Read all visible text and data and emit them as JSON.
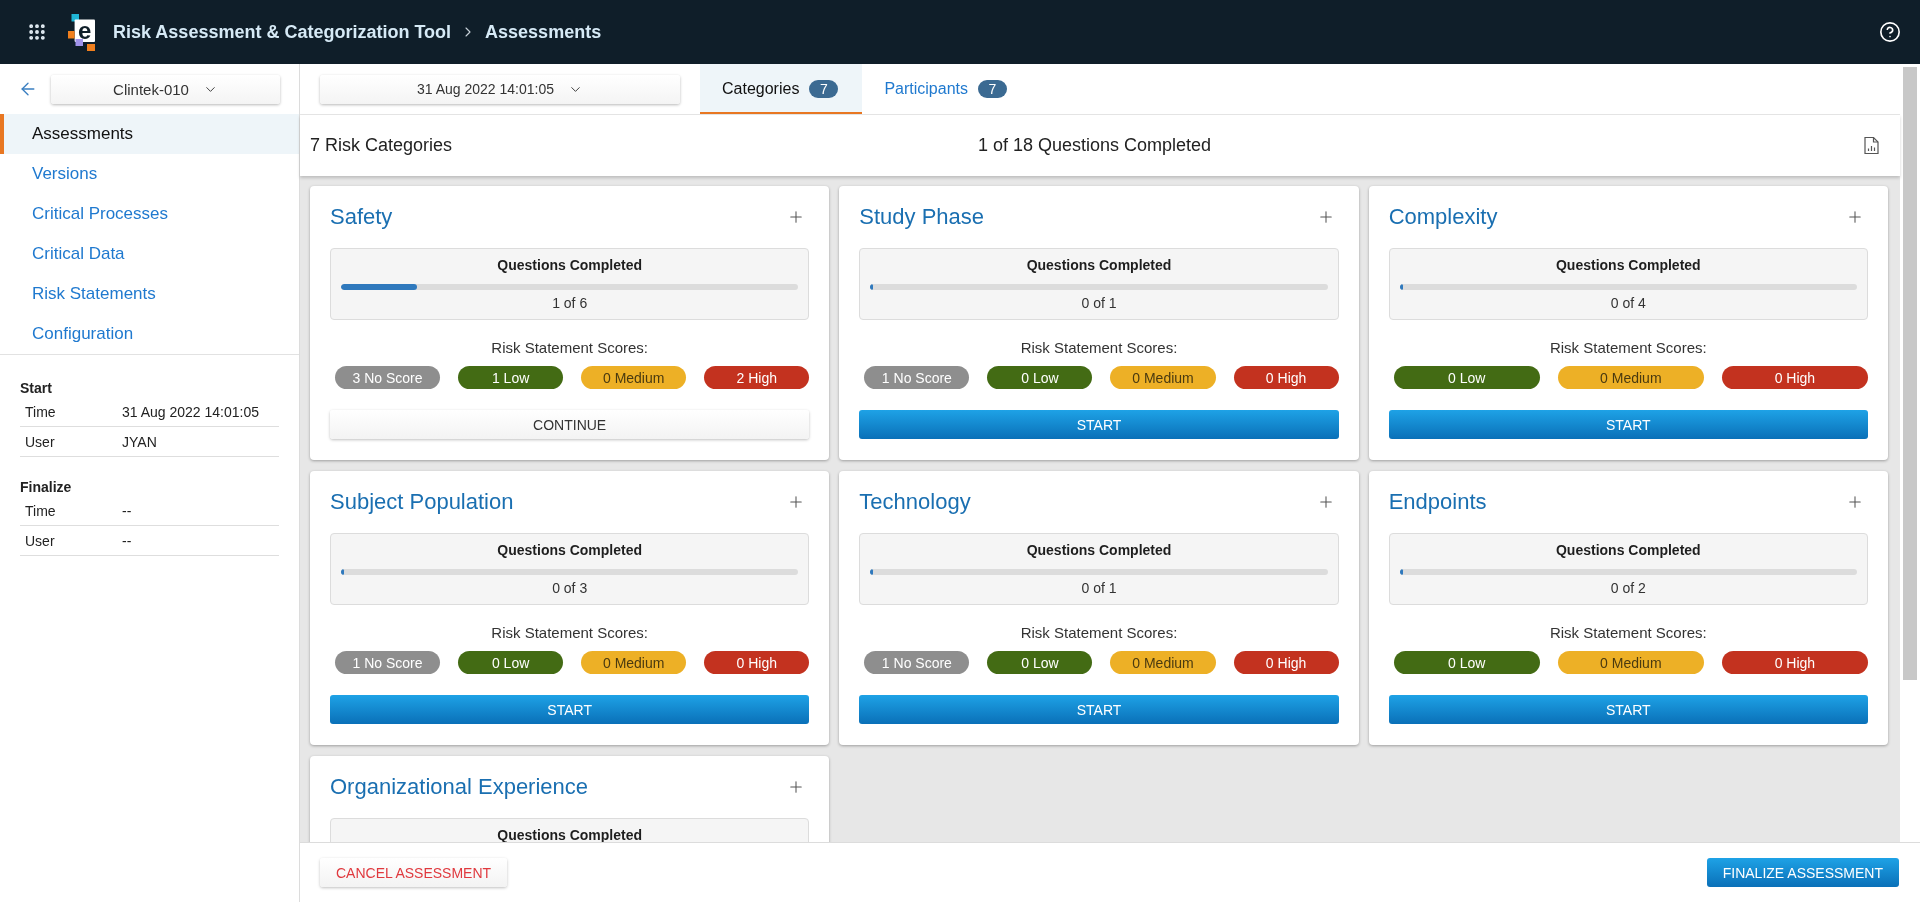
{
  "app_bar": {
    "logo_letter": "e",
    "title": "Risk Assessment & Categorization Tool",
    "page": "Assessments"
  },
  "sidebar": {
    "study": "Clintek-010",
    "nav": [
      {
        "label": "Assessments",
        "selected": true
      },
      {
        "label": "Versions",
        "selected": false
      },
      {
        "label": "Critical Processes",
        "selected": false
      },
      {
        "label": "Critical Data",
        "selected": false
      },
      {
        "label": "Risk Statements",
        "selected": false
      },
      {
        "label": "Configuration",
        "selected": false
      }
    ],
    "sections": [
      {
        "title": "Start",
        "rows": [
          {
            "label": "Time",
            "value": "31 Aug 2022 14:01:05"
          },
          {
            "label": "User",
            "value": "JYAN"
          }
        ]
      },
      {
        "title": "Finalize",
        "rows": [
          {
            "label": "Time",
            "value": "--"
          },
          {
            "label": "User",
            "value": "--"
          }
        ]
      }
    ]
  },
  "toolbar": {
    "version": "31 Aug 2022 14:01:05",
    "tabs": [
      {
        "label": "Categories",
        "count": "7",
        "selected": true
      },
      {
        "label": "Participants",
        "count": "7",
        "selected": false
      }
    ]
  },
  "summary": {
    "title": "7 Risk Categories",
    "progress": "1 of 18 Questions Completed"
  },
  "categories": [
    {
      "title": "Safety",
      "progress_label": "Questions Completed",
      "level": 0.167,
      "count": "1 of 6",
      "scores_label": "Risk Statement Scores:",
      "scores": [
        {
          "label": "3 No Score",
          "color": "#8e8e8e"
        },
        {
          "label": "1 Low",
          "color": "#436b14"
        },
        {
          "label": "0 Medium",
          "color": "#edb026"
        },
        {
          "label": "2 High",
          "color": "#c3321f"
        }
      ],
      "action": {
        "label": "CONTINUE",
        "kind": "secondary"
      }
    },
    {
      "title": "Study Phase",
      "progress_label": "Questions Completed",
      "level": 0,
      "count": "0 of 1",
      "scores_label": "Risk Statement Scores:",
      "scores": [
        {
          "label": "1 No Score",
          "color": "#8e8e8e"
        },
        {
          "label": "0 Low",
          "color": "#436b14"
        },
        {
          "label": "0 Medium",
          "color": "#edb026"
        },
        {
          "label": "0 High",
          "color": "#c3321f"
        }
      ],
      "action": {
        "label": "START",
        "kind": "primary"
      }
    },
    {
      "title": "Complexity",
      "progress_label": "Questions Completed",
      "level": 0,
      "count": "0 of 4",
      "scores_label": "Risk Statement Scores:",
      "scores": [
        {
          "label": "0 Low",
          "color": "#436b14"
        },
        {
          "label": "0 Medium",
          "color": "#edb026"
        },
        {
          "label": "0 High",
          "color": "#c3321f"
        }
      ],
      "action": {
        "label": "START",
        "kind": "primary"
      }
    },
    {
      "title": "Subject Population",
      "progress_label": "Questions Completed",
      "level": 0,
      "count": "0 of 3",
      "scores_label": "Risk Statement Scores:",
      "scores": [
        {
          "label": "1 No Score",
          "color": "#8e8e8e"
        },
        {
          "label": "0 Low",
          "color": "#436b14"
        },
        {
          "label": "0 Medium",
          "color": "#edb026"
        },
        {
          "label": "0 High",
          "color": "#c3321f"
        }
      ],
      "action": {
        "label": "START",
        "kind": "primary"
      }
    },
    {
      "title": "Technology",
      "progress_label": "Questions Completed",
      "level": 0,
      "count": "0 of 1",
      "scores_label": "Risk Statement Scores:",
      "scores": [
        {
          "label": "1 No Score",
          "color": "#8e8e8e"
        },
        {
          "label": "0 Low",
          "color": "#436b14"
        },
        {
          "label": "0 Medium",
          "color": "#edb026"
        },
        {
          "label": "0 High",
          "color": "#c3321f"
        }
      ],
      "action": {
        "label": "START",
        "kind": "primary"
      }
    },
    {
      "title": "Endpoints",
      "progress_label": "Questions Completed",
      "level": 0,
      "count": "0 of 2",
      "scores_label": "Risk Statement Scores:",
      "scores": [
        {
          "label": "0 Low",
          "color": "#436b14"
        },
        {
          "label": "0 Medium",
          "color": "#edb026"
        },
        {
          "label": "0 High",
          "color": "#c3321f"
        }
      ],
      "action": {
        "label": "START",
        "kind": "primary"
      }
    },
    {
      "title": "Organizational Experience",
      "progress_label": "Questions Completed"
    }
  ],
  "footer": {
    "buttons": [
      {
        "label": "CANCEL ASSESSMENT",
        "kind": "danger"
      },
      {
        "label": "FINALIZE ASSESSMENT",
        "kind": "primary"
      }
    ]
  }
}
